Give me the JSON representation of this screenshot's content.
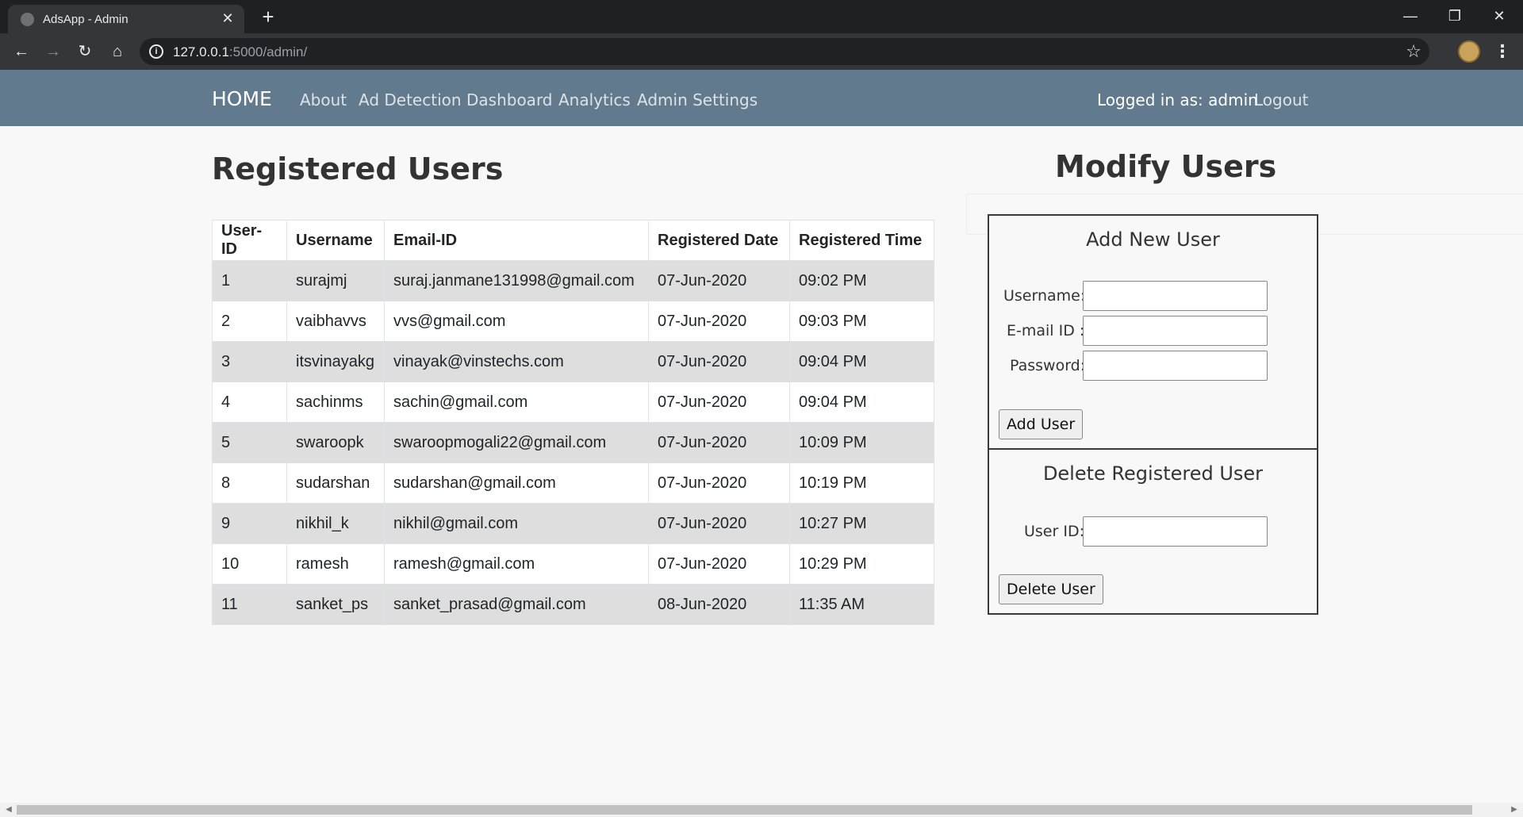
{
  "browser": {
    "tab_title": "AdsApp - Admin",
    "url_host": "127.0.0.1",
    "url_rest": ":5000/admin/",
    "new_tab": "+",
    "close": "✕",
    "minimize": "—",
    "restore": "❐",
    "window_close": "✕"
  },
  "navbar": {
    "brand": "HOME",
    "links": [
      "About",
      "Ad Detection",
      "Dashboard",
      "Analytics",
      "Admin Settings"
    ],
    "logged_in": "Logged in as: admin",
    "logout": "Logout"
  },
  "registered": {
    "title": "Registered Users",
    "columns": [
      "User-ID",
      "Username",
      "Email-ID",
      "Registered Date",
      "Registered Time"
    ],
    "rows": [
      [
        "1",
        "surajmj",
        "suraj.janmane131998@gmail.com",
        "07-Jun-2020",
        "09:02 PM"
      ],
      [
        "2",
        "vaibhavvs",
        "vvs@gmail.com",
        "07-Jun-2020",
        "09:03 PM"
      ],
      [
        "3",
        "itsvinayakg",
        "vinayak@vinstechs.com",
        "07-Jun-2020",
        "09:04 PM"
      ],
      [
        "4",
        "sachinms",
        "sachin@gmail.com",
        "07-Jun-2020",
        "09:04 PM"
      ],
      [
        "5",
        "swaroopk",
        "swaroopmogali22@gmail.com",
        "07-Jun-2020",
        "10:09 PM"
      ],
      [
        "8",
        "sudarshan",
        "sudarshan@gmail.com",
        "07-Jun-2020",
        "10:19 PM"
      ],
      [
        "9",
        "nikhil_k",
        "nikhil@gmail.com",
        "07-Jun-2020",
        "10:27 PM"
      ],
      [
        "10",
        "ramesh",
        "ramesh@gmail.com",
        "07-Jun-2020",
        "10:29 PM"
      ],
      [
        "11",
        "sanket_ps",
        "sanket_prasad@gmail.com",
        "08-Jun-2020",
        "11:35 AM"
      ]
    ]
  },
  "modify": {
    "title": "Modify Users",
    "add": {
      "title": "Add New User",
      "username_label": "Username:",
      "email_label": "E-mail ID :",
      "password_label": "Password:",
      "button": "Add User"
    },
    "delete": {
      "title": "Delete Registered User",
      "userid_label": "User ID:",
      "button": "Delete User"
    }
  }
}
